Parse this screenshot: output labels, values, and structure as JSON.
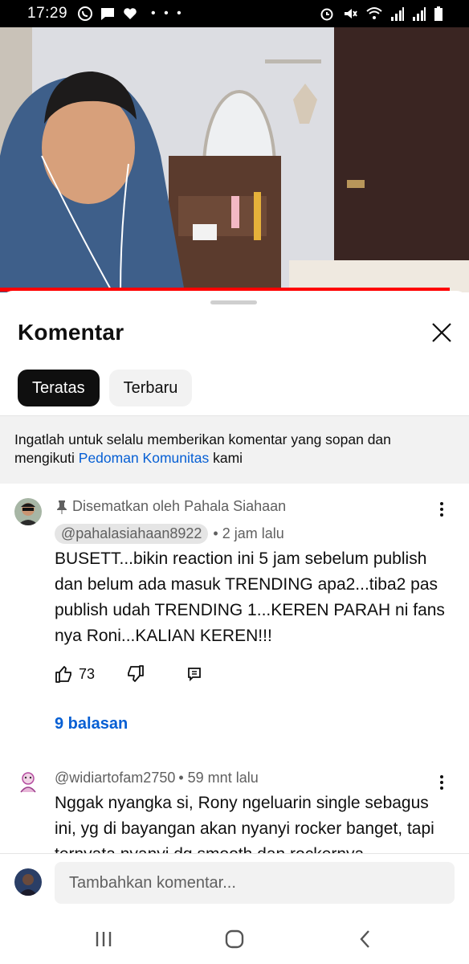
{
  "status_bar": {
    "time": "17:29",
    "left_icons": [
      "whatsapp-icon",
      "message-icon",
      "heart-icon"
    ],
    "more_dots": "• • •",
    "right_icons": [
      "alarm-icon",
      "mute-icon",
      "wifi-icon",
      "signal-icon",
      "signal-icon",
      "battery-icon"
    ]
  },
  "sheet": {
    "title": "Komentar",
    "tabs": [
      {
        "label": "Teratas",
        "active": true
      },
      {
        "label": "Terbaru",
        "active": false
      }
    ],
    "notice": {
      "text_before": "Ingatlah untuk selalu memberikan komentar yang sopan dan mengikuti ",
      "link": "Pedoman Komunitas",
      "text_after": " kami"
    }
  },
  "comments": [
    {
      "pinned_label": "Disematkan oleh Pahala Siahaan",
      "author": "@pahalasiahaan8922",
      "time": "• 2 jam lalu",
      "text": "BUSETT...bikin reaction ini 5 jam sebelum publish dan belum ada masuk TRENDING apa2...tiba2 pas publish udah TRENDING 1...KEREN PARAH ni fans nya Roni...KALIAN KEREN!!!",
      "likes": "73",
      "replies": "9 balasan"
    },
    {
      "author": "@widiartofam2750",
      "time": "• 59 mnt lalu",
      "text": "Nggak nyangka si, Rony ngeluarin single sebagus ini, yg di bayangan akan nyanyi rocker banget, tapi ternyata nyanyi dg smooth dan rockernya"
    }
  ],
  "composer": {
    "placeholder": "Tambahkan komentar..."
  },
  "colors": {
    "link": "#065fd4",
    "progress": "#ff0000",
    "chip_active": "#0f0f0f"
  }
}
